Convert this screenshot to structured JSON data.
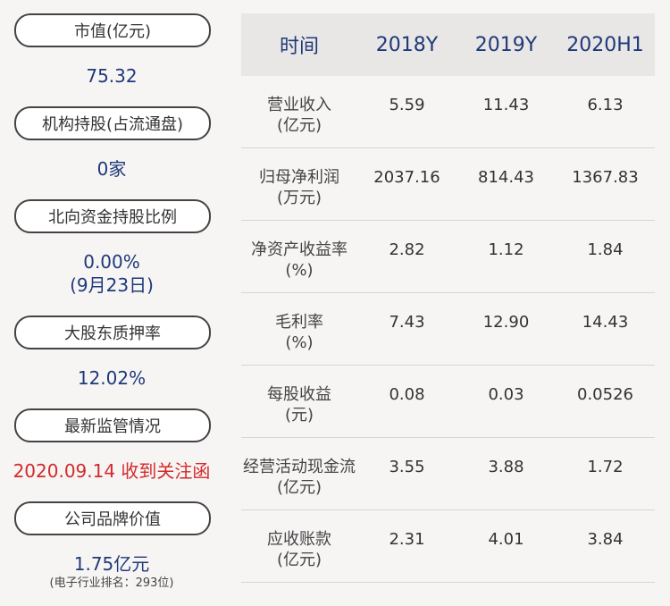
{
  "left": {
    "market_cap_label": "市值(亿元)",
    "market_cap_value": "75.32",
    "institution_label": "机构持股(占流通盘)",
    "institution_value": "0家",
    "northbound_label": "北向资金持股比例",
    "northbound_value": "0.00%",
    "northbound_date": "(9月23日)",
    "pledge_label": "大股东质押率",
    "pledge_value": "12.02%",
    "regulation_label": "最新监管情况",
    "regulation_value": "2020.09.14 收到关注函",
    "brand_label": "公司品牌价值",
    "brand_value": "1.75亿元",
    "brand_rank": "(电子行业排名：293位)"
  },
  "table": {
    "headers": [
      "时间",
      "2018Y",
      "2019Y",
      "2020H1"
    ],
    "rows": [
      {
        "label1": "营业收入",
        "label2": "(亿元)",
        "v2018": "5.59",
        "v2019": "11.43",
        "v2020": "6.13"
      },
      {
        "label1": "归母净利润",
        "label2": "(万元)",
        "v2018": "2037.16",
        "v2019": "814.43",
        "v2020": "1367.83"
      },
      {
        "label1": "净资产收益率",
        "label2": "(%)",
        "v2018": "2.82",
        "v2019": "1.12",
        "v2020": "1.84"
      },
      {
        "label1": "毛利率",
        "label2": "(%)",
        "v2018": "7.43",
        "v2019": "12.90",
        "v2020": "14.43"
      },
      {
        "label1": "每股收益",
        "label2": "(元)",
        "v2018": "0.08",
        "v2019": "0.03",
        "v2020": "0.0526"
      },
      {
        "label1": "经营活动现金流",
        "label2": "(亿元)",
        "v2018": "3.55",
        "v2019": "3.88",
        "v2020": "1.72"
      },
      {
        "label1": "应收账款",
        "label2": "(亿元)",
        "v2018": "2.31",
        "v2019": "4.01",
        "v2020": "3.84"
      }
    ]
  }
}
